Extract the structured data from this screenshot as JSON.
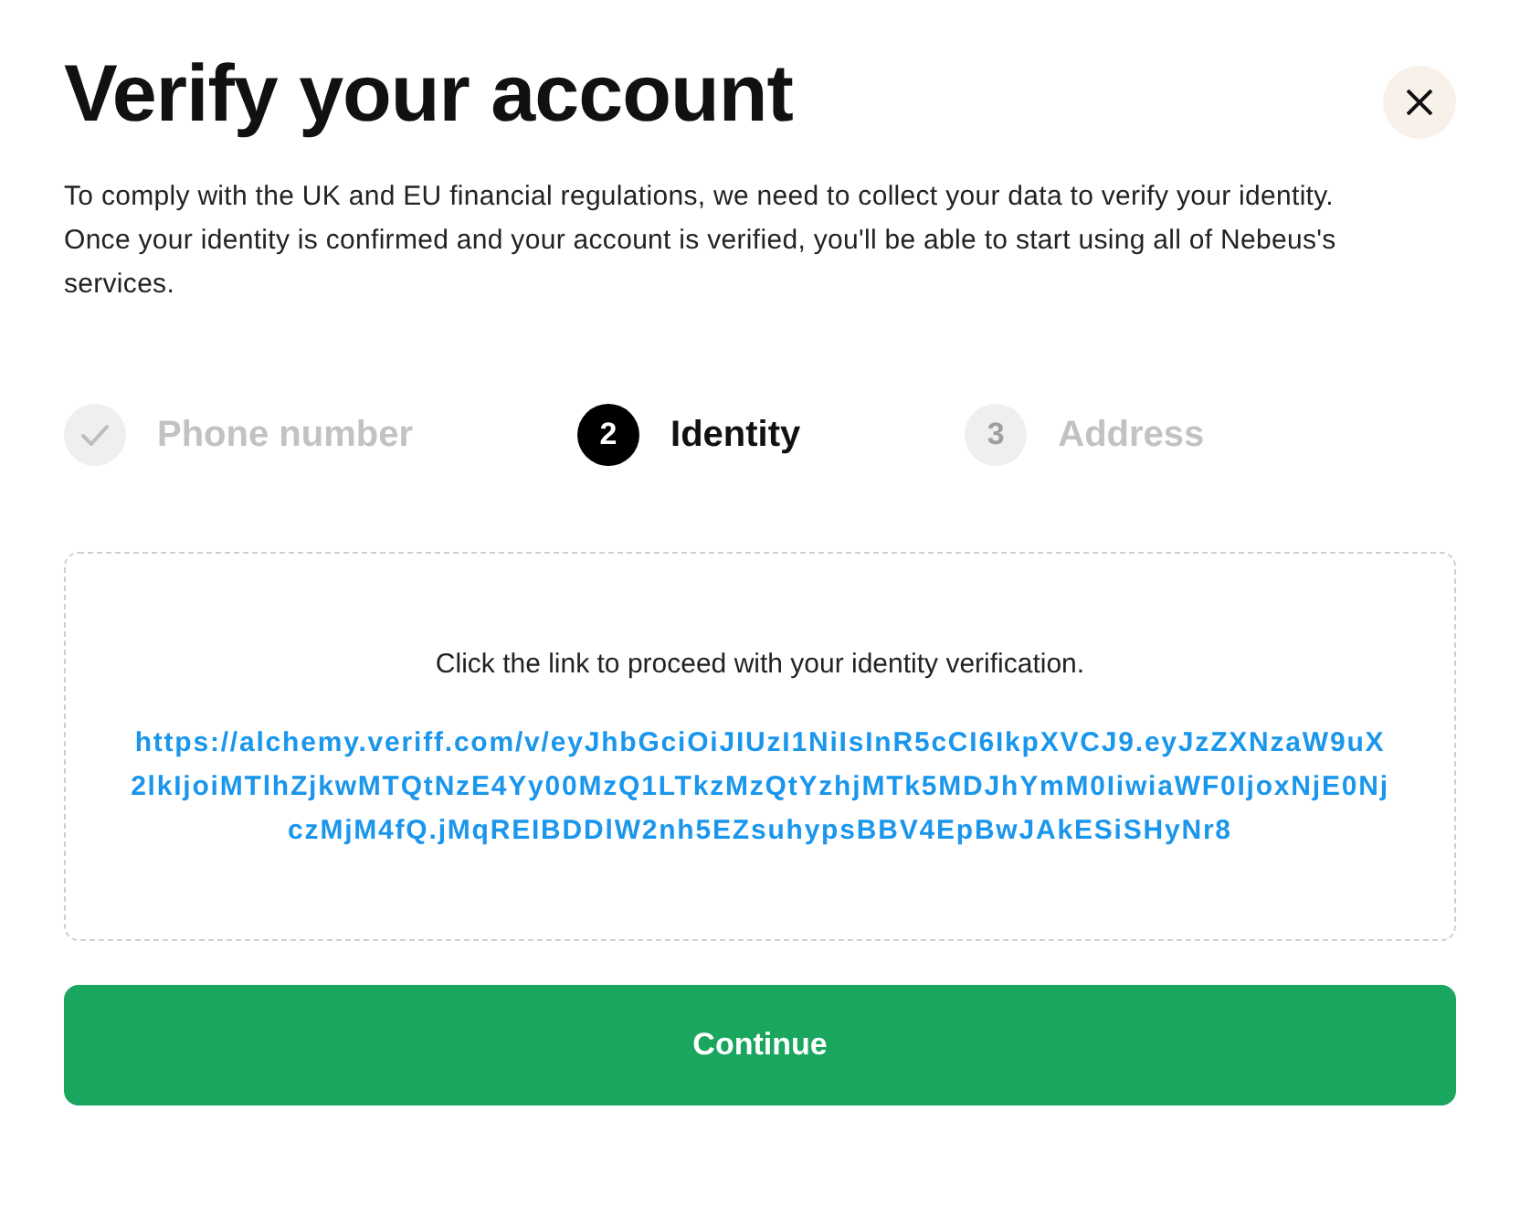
{
  "dialog": {
    "title": "Verify your account",
    "description": "To comply with the UK and EU financial regulations, we need to collect your data to verify your identity. Once your identity is confirmed and your account is verified, you'll be able to start using all of Nebeus's services."
  },
  "steps": [
    {
      "label": "Phone number",
      "completed": true,
      "selected": false
    },
    {
      "number": "2",
      "label": "Identity",
      "completed": false,
      "selected": true
    },
    {
      "number": "3",
      "label": "Address",
      "completed": false,
      "selected": false
    }
  ],
  "verification_panel": {
    "instruction": "Click the link to proceed with your identity verification.",
    "link": "https://alchemy.veriff.com/v/eyJhbGciOiJIUzI1NiIsInR5cCI6IkpXVCJ9.eyJzZXNzaW9uX2lkIjoiMTlhZjkwMTQtNzE4Yy00MzQ1LTkzMzQtYzhjMTk5MDJhYmM0IiwiaWF0IjoxNjE0NjczMjM4fQ.jMqREIBDDlW2nh5EZsuhypsBBV4EpBwJAkESiSHyNr8"
  },
  "primary_button": {
    "label": "Continue"
  }
}
